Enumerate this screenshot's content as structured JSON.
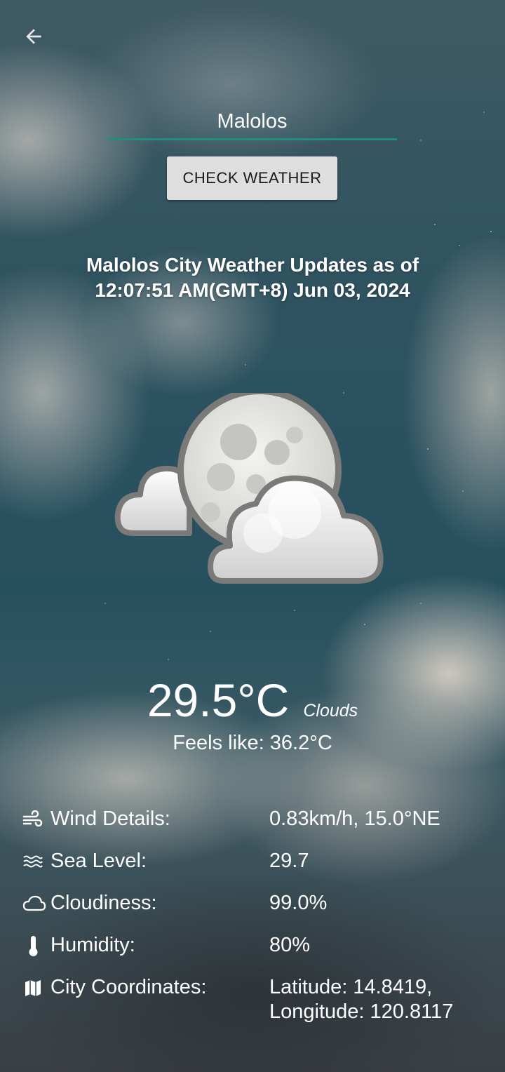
{
  "nav": {
    "back_icon": "arrow-back-icon"
  },
  "search": {
    "value": "Malolos",
    "button_label": "CHECK WEATHER"
  },
  "header": {
    "line1": "Malolos City Weather Updates as of",
    "line2": "12:07:51 AM(GMT+8) Jun 03, 2024"
  },
  "illustration": {
    "icon": "moon-clouds-icon"
  },
  "current": {
    "temperature": "29.5°C",
    "description": "Clouds",
    "feels_like": "Feels like: 36.2°C"
  },
  "details": {
    "wind": {
      "icon": "wind-icon",
      "label": "Wind Details:",
      "value": "0.83km/h, 15.0°NE"
    },
    "sea_level": {
      "icon": "waves-icon",
      "label": "Sea Level:",
      "value": "29.7"
    },
    "cloudiness": {
      "icon": "cloud-icon",
      "label": "Cloudiness:",
      "value": "99.0%"
    },
    "humidity": {
      "icon": "thermometer-icon",
      "label": "Humidity:",
      "value": "80%"
    },
    "coordinates": {
      "icon": "map-icon",
      "label": "City Coordinates:",
      "value_line1": "Latitude: 14.8419,",
      "value_line2": "Longitude: 120.8117"
    }
  },
  "colors": {
    "input_underline": "#1f8f7f",
    "button_bg": "#dedede"
  }
}
